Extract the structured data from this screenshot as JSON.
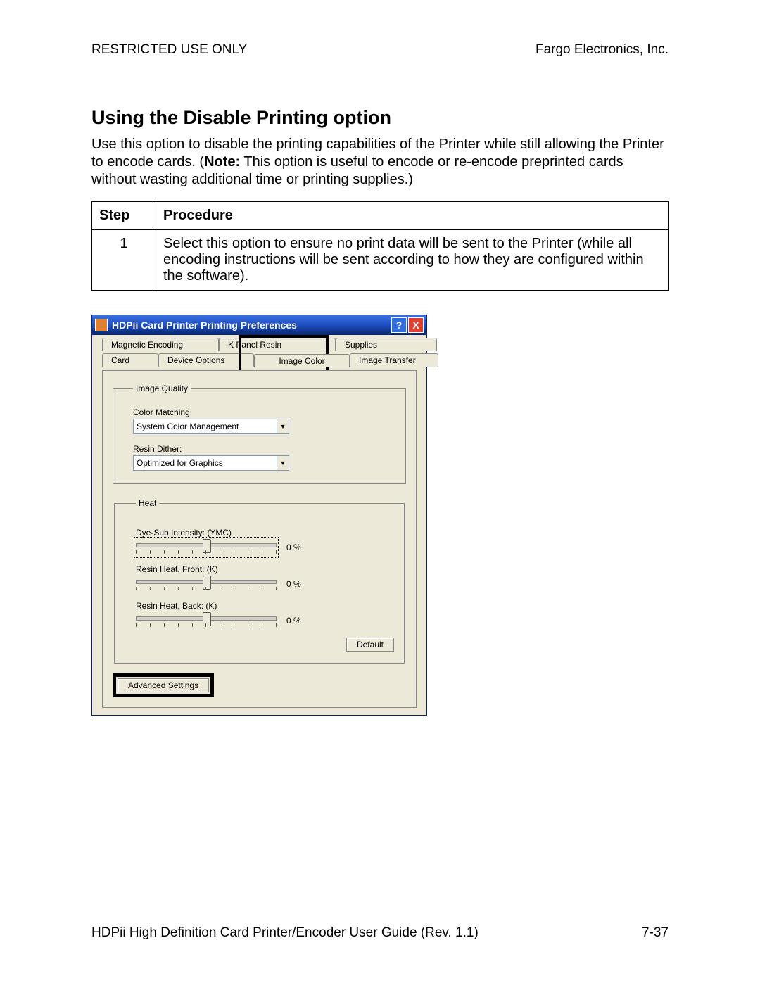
{
  "header": {
    "left": "RESTRICTED USE ONLY",
    "right": "Fargo Electronics, Inc."
  },
  "title": "Using the Disable Printing option",
  "intro_prefix": "Use this option to disable the printing capabilities of the Printer while still allowing the Printer to encode cards. (",
  "intro_note_label": "Note:",
  "intro_suffix": "  This option is useful to encode or re-encode preprinted cards without wasting additional time or printing supplies.)",
  "table": {
    "col_step": "Step",
    "col_proc": "Procedure",
    "rows": [
      {
        "step": "1",
        "text": "Select this option to ensure no print data will be sent to the Printer (while all encoding instructions will be sent according to how they are configured within the software)."
      }
    ]
  },
  "dialog": {
    "title": "HDPii Card Printer Printing Preferences",
    "tabs_row1": [
      "Magnetic Encoding",
      "K Panel Resin",
      "Supplies"
    ],
    "tabs_row2": [
      "Card",
      "Device Options",
      "Image Color",
      "Image Transfer"
    ],
    "image_quality": {
      "legend": "Image Quality",
      "color_matching_label": "Color Matching:",
      "color_matching_value": "System Color Management",
      "resin_dither_label": "Resin Dither:",
      "resin_dither_value": "Optimized for Graphics"
    },
    "heat": {
      "legend": "Heat",
      "sliders": [
        {
          "label": "Dye-Sub Intensity:  (YMC)",
          "value": "0  %"
        },
        {
          "label": "Resin Heat, Front:  (K)",
          "value": "0  %"
        },
        {
          "label": "Resin Heat, Back:    (K)",
          "value": "0  %"
        }
      ],
      "default_btn": "Default"
    },
    "advanced_btn": "Advanced Settings"
  },
  "footer": {
    "left": "HDPii High Definition Card Printer/Encoder User Guide (Rev. 1.1)",
    "right": "7-37"
  }
}
